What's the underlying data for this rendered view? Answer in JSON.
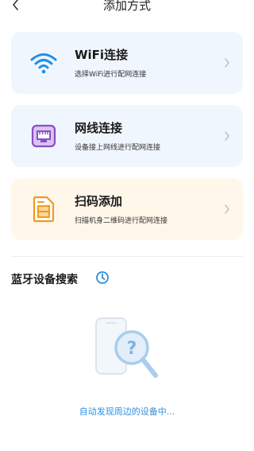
{
  "header": {
    "title": "添加方式",
    "back_icon": "chevron-left-icon"
  },
  "methods": [
    {
      "icon": "wifi-icon",
      "label": "WiFi连接",
      "description": "选择WiFi进行配网连接",
      "bg": "#f0f6fd"
    },
    {
      "icon": "ethernet-icon",
      "label": "网线连接",
      "description": "设备接上网线进行配网连接",
      "bg": "#f0f6fd"
    },
    {
      "icon": "qr-scan-icon",
      "label": "扫码添加",
      "description": "扫描机身二维码进行配网连接",
      "bg": "#fff7ea"
    }
  ],
  "bluetooth": {
    "title": "蓝牙设备搜索",
    "status_icon": "loading-icon",
    "illustration": "phone-search-icon",
    "status_text": "自动发现周边的设备中..."
  },
  "colors": {
    "accent_blue": "#2c8fe0",
    "wifi_blue": "#1e90e8",
    "lan_purple": "#8a4fc4",
    "scan_orange": "#f29a1b"
  }
}
